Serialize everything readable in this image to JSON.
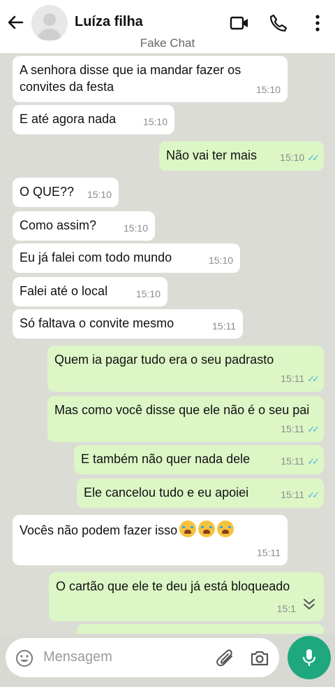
{
  "header": {
    "contact_name": "Luíza filha",
    "subtitle": "Fake Chat"
  },
  "messages": [
    {
      "dir": "in",
      "text": "A senhora disse que ia mandar fazer os convites da festa",
      "time": "15:10"
    },
    {
      "dir": "in",
      "text": "E até agora nada",
      "time": "15:10"
    },
    {
      "dir": "out",
      "text": "Não vai ter mais",
      "time": "15:10",
      "ticks": "✓✓"
    },
    {
      "dir": "in",
      "text": "O QUE??",
      "time": "15:10"
    },
    {
      "dir": "in",
      "text": "Como assim?",
      "time": "15:10"
    },
    {
      "dir": "in",
      "text": "Eu já falei com todo mundo",
      "time": "15:10"
    },
    {
      "dir": "in",
      "text": "Falei até o local",
      "time": "15:10"
    },
    {
      "dir": "in",
      "text": "Só faltava o convite mesmo",
      "time": "15:11"
    },
    {
      "dir": "out",
      "text": "Quem ia pagar tudo era o seu padrasto",
      "time": "15:11",
      "ticks": "✓✓"
    },
    {
      "dir": "out",
      "text": "Mas como você disse que ele não é o seu pai",
      "time": "15:11",
      "ticks": "✓✓"
    },
    {
      "dir": "out",
      "text": "E também não quer nada dele",
      "time": "15:11",
      "ticks": "✓✓"
    },
    {
      "dir": "out",
      "text": "Ele cancelou tudo e eu apoiei",
      "time": "15:11",
      "ticks": "✓✓"
    },
    {
      "dir": "in",
      "text": "Vocês não podem fazer isso",
      "time": "15:11",
      "emojis": [
        "crying-face",
        "crying-face",
        "crying-face"
      ]
    },
    {
      "dir": "out",
      "text": "O cartão que ele te deu já está bloqueado",
      "time": "15:1"
    }
  ],
  "composer": {
    "placeholder": "Mensagem"
  },
  "colors": {
    "incoming": "#ffffff",
    "outgoing": "#dcf6c6",
    "read_ticks": "#4fb3e7",
    "mic_button": "#1fa87e"
  },
  "icons": [
    "back-arrow-icon",
    "avatar-icon",
    "video-call-icon",
    "phone-icon",
    "more-vert-icon",
    "emoji-icon",
    "attach-icon",
    "camera-icon",
    "mic-icon",
    "scroll-down-icon"
  ]
}
